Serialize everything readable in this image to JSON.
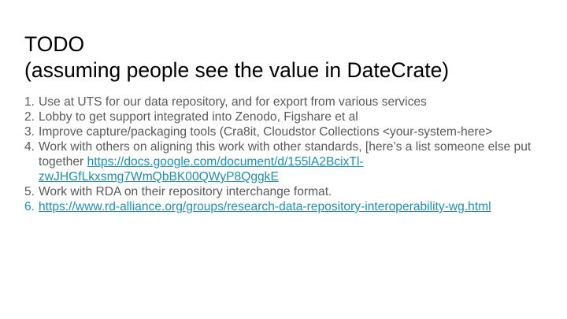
{
  "slide": {
    "title_line1": "TODO",
    "title_line2": "(assuming people see the value in DateCrate)",
    "items": [
      {
        "number": "1.",
        "text": "Use at UTS for our data repository, and for export from various services"
      },
      {
        "number": "2.",
        "text": "Lobby to get support integrated into Zenodo, Figshare et al"
      },
      {
        "number": "3.",
        "text": "Improve capture/packaging tools (Cra8it, Cloudstor Collections <your-system-here>"
      },
      {
        "number": "4.",
        "text": "Work with others on aligning this work with other standards, [here’s a list someone else put together ",
        "link": "https://docs.google.com/document/d/155lA2BcixTl-zwJHGfLkxsmg7WmQbBK00QWyP8QggkE"
      },
      {
        "number": "5.",
        "text": "Work with RDA on their repository interchange format."
      },
      {
        "number": "6.",
        "link": "https://www.rd-alliance.org/groups/research-data-repository-interoperability-wg.html"
      }
    ],
    "colors": {
      "title": "#000000",
      "body": "#595959",
      "link": "#1a8fb5",
      "background": "#ffffff"
    }
  }
}
